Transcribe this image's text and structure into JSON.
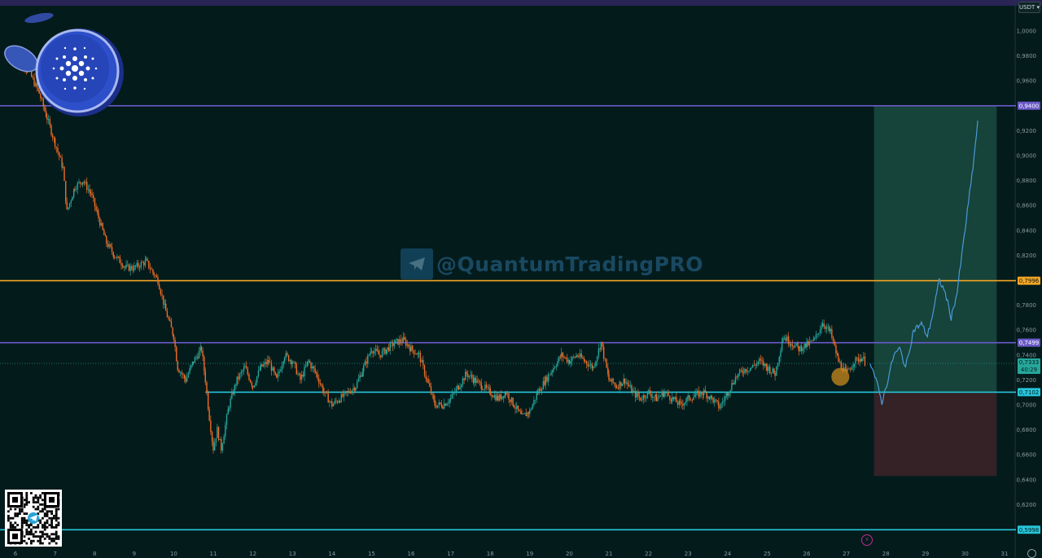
{
  "currency": "USDT ▾",
  "watermark": "@QuantumTradingPRO",
  "colors": {
    "background": "#041b1c",
    "up": "#26a69a",
    "down": "#ef6c25",
    "projection": "#4a9ad8",
    "resistance_purple": "#6a5ac8",
    "level_orange": "#f5a623",
    "support_cyan": "#26c6da",
    "target_zone": "#1a4a40",
    "stop_zone": "#3a2428"
  },
  "chart_data": {
    "type": "candlestick",
    "ylim": [
      0.585,
      1.022
    ],
    "price_ticks": [
      "1,0000",
      "0,9800",
      "0,9600",
      "0,9200",
      "0,9000",
      "0,8800",
      "0,8600",
      "0,8400",
      "0,8200",
      "0,7800",
      "0,7600",
      "0,7400",
      "0,7200",
      "0,7000",
      "0,6800",
      "0,6600",
      "0,6400",
      "0,6200"
    ],
    "date_ticks": [
      "6",
      "7",
      "8",
      "9",
      "10",
      "11",
      "12",
      "13",
      "14",
      "15",
      "16",
      "17",
      "18",
      "19",
      "20",
      "21",
      "22",
      "23",
      "24",
      "25",
      "26",
      "27",
      "28",
      "29",
      "30",
      "31"
    ],
    "levels": [
      {
        "label": "0,9400",
        "value": 0.94,
        "color": "#6a5ac8",
        "span": "full"
      },
      {
        "label": "0,7996",
        "value": 0.7996,
        "color": "#f5a623",
        "span": "full"
      },
      {
        "label": "0,7499",
        "value": 0.7499,
        "color": "#6a5ac8",
        "span": "full"
      },
      {
        "label": "0,7102",
        "value": 0.7102,
        "color": "#26c6da",
        "span": "partial"
      },
      {
        "label": "0,5998",
        "value": 0.5998,
        "color": "#26c6da",
        "span": "full"
      }
    ],
    "current_price": {
      "label": "0,7333",
      "timer": "40:29",
      "value": 0.7333
    },
    "close_path": [
      [
        6.0,
        0.985
      ],
      [
        6.3,
        0.97
      ],
      [
        6.6,
        0.95
      ],
      [
        6.8,
        0.93
      ],
      [
        7.0,
        0.91
      ],
      [
        7.2,
        0.89
      ],
      [
        7.3,
        0.855
      ],
      [
        7.5,
        0.875
      ],
      [
        7.7,
        0.88
      ],
      [
        7.9,
        0.87
      ],
      [
        8.1,
        0.85
      ],
      [
        8.3,
        0.83
      ],
      [
        8.5,
        0.82
      ],
      [
        8.8,
        0.81
      ],
      [
        9.0,
        0.81
      ],
      [
        9.3,
        0.815
      ],
      [
        9.5,
        0.805
      ],
      [
        9.6,
        0.8
      ],
      [
        9.8,
        0.775
      ],
      [
        10.0,
        0.755
      ],
      [
        10.1,
        0.73
      ],
      [
        10.3,
        0.72
      ],
      [
        10.5,
        0.735
      ],
      [
        10.7,
        0.745
      ],
      [
        10.8,
        0.72
      ],
      [
        10.9,
        0.69
      ],
      [
        11.0,
        0.665
      ],
      [
        11.1,
        0.68
      ],
      [
        11.2,
        0.665
      ],
      [
        11.4,
        0.7
      ],
      [
        11.6,
        0.72
      ],
      [
        11.8,
        0.73
      ],
      [
        12.0,
        0.715
      ],
      [
        12.2,
        0.73
      ],
      [
        12.4,
        0.735
      ],
      [
        12.6,
        0.72
      ],
      [
        12.8,
        0.74
      ],
      [
        13.0,
        0.735
      ],
      [
        13.2,
        0.72
      ],
      [
        13.4,
        0.735
      ],
      [
        13.6,
        0.725
      ],
      [
        13.8,
        0.71
      ],
      [
        14.0,
        0.7
      ],
      [
        14.2,
        0.705
      ],
      [
        14.4,
        0.71
      ],
      [
        14.6,
        0.715
      ],
      [
        14.8,
        0.73
      ],
      [
        15.0,
        0.745
      ],
      [
        15.2,
        0.74
      ],
      [
        15.4,
        0.745
      ],
      [
        15.6,
        0.75
      ],
      [
        15.8,
        0.752
      ],
      [
        16.0,
        0.745
      ],
      [
        16.2,
        0.74
      ],
      [
        16.4,
        0.72
      ],
      [
        16.6,
        0.7
      ],
      [
        16.8,
        0.7
      ],
      [
        17.0,
        0.705
      ],
      [
        17.2,
        0.715
      ],
      [
        17.4,
        0.725
      ],
      [
        17.6,
        0.72
      ],
      [
        17.8,
        0.715
      ],
      [
        18.0,
        0.71
      ],
      [
        18.2,
        0.705
      ],
      [
        18.4,
        0.71
      ],
      [
        18.6,
        0.7
      ],
      [
        18.8,
        0.69
      ],
      [
        19.0,
        0.695
      ],
      [
        19.2,
        0.71
      ],
      [
        19.4,
        0.72
      ],
      [
        19.6,
        0.73
      ],
      [
        19.8,
        0.74
      ],
      [
        20.0,
        0.735
      ],
      [
        20.2,
        0.74
      ],
      [
        20.4,
        0.735
      ],
      [
        20.6,
        0.73
      ],
      [
        20.8,
        0.75
      ],
      [
        21.0,
        0.72
      ],
      [
        21.2,
        0.715
      ],
      [
        21.4,
        0.72
      ],
      [
        21.6,
        0.71
      ],
      [
        21.8,
        0.705
      ],
      [
        22.0,
        0.71
      ],
      [
        22.2,
        0.705
      ],
      [
        22.4,
        0.71
      ],
      [
        22.6,
        0.705
      ],
      [
        22.8,
        0.7
      ],
      [
        23.0,
        0.705
      ],
      [
        23.2,
        0.708
      ],
      [
        23.4,
        0.71
      ],
      [
        23.6,
        0.705
      ],
      [
        23.8,
        0.698
      ],
      [
        24.0,
        0.71
      ],
      [
        24.2,
        0.722
      ],
      [
        24.4,
        0.728
      ],
      [
        24.6,
        0.73
      ],
      [
        24.8,
        0.735
      ],
      [
        25.0,
        0.73
      ],
      [
        25.2,
        0.725
      ],
      [
        25.4,
        0.755
      ],
      [
        25.6,
        0.75
      ],
      [
        25.8,
        0.745
      ],
      [
        26.0,
        0.748
      ],
      [
        26.2,
        0.752
      ],
      [
        26.4,
        0.766
      ],
      [
        26.6,
        0.758
      ],
      [
        26.8,
        0.735
      ],
      [
        27.0,
        0.725
      ],
      [
        27.2,
        0.735
      ],
      [
        27.4,
        0.738
      ],
      [
        27.5,
        0.733
      ]
    ],
    "projection_path": [
      [
        27.6,
        0.735
      ],
      [
        27.75,
        0.72
      ],
      [
        27.9,
        0.702
      ],
      [
        28.05,
        0.72
      ],
      [
        28.2,
        0.74
      ],
      [
        28.35,
        0.745
      ],
      [
        28.5,
        0.73
      ],
      [
        28.7,
        0.76
      ],
      [
        28.9,
        0.765
      ],
      [
        29.05,
        0.755
      ],
      [
        29.2,
        0.775
      ],
      [
        29.35,
        0.8
      ],
      [
        29.5,
        0.79
      ],
      [
        29.65,
        0.77
      ],
      [
        29.8,
        0.79
      ],
      [
        30.0,
        0.84
      ],
      [
        30.2,
        0.89
      ],
      [
        30.35,
        0.935
      ]
    ],
    "target_zone": {
      "x_start": 27.7,
      "x_end": 30.8,
      "y_top": 0.9395,
      "y_bottom": 0.7102
    },
    "stop_zone": {
      "x_start": 27.7,
      "x_end": 30.8,
      "y_top": 0.7102,
      "y_bottom": 0.643
    },
    "entry_marker": {
      "x": 26.85,
      "y": 0.7225
    }
  }
}
